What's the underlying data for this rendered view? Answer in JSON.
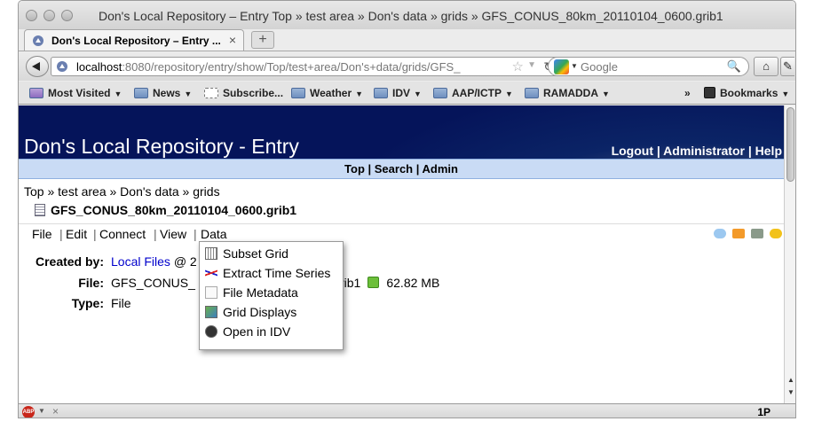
{
  "window": {
    "title": "Don's Local Repository – Entry Top » test area » Don's data » grids » GFS_CONUS_80km_20110104_0600.grib1"
  },
  "tab": {
    "label": "Don's Local Repository – Entry ...",
    "close": "×",
    "new_tab": "+"
  },
  "navbar": {
    "url_host": "localhost",
    "url_path": ":8080/repository/entry/show/Top/test+area/Don's+data/grids/GFS_",
    "search_placeholder": "Google"
  },
  "bookmarks": {
    "items": [
      {
        "label": "Most Visited",
        "has_menu": true
      },
      {
        "label": "News",
        "has_menu": true
      },
      {
        "label": "Subscribe...",
        "has_menu": false
      },
      {
        "label": "Weather",
        "has_menu": true
      },
      {
        "label": "IDV",
        "has_menu": true
      },
      {
        "label": "AAP/ICTP",
        "has_menu": true
      },
      {
        "label": "RAMADDA",
        "has_menu": true
      }
    ],
    "overflow": "»",
    "bookmarks_label": "Bookmarks"
  },
  "site": {
    "title": "Don's Local Repository - Entry",
    "header_links": "Logout | Administrator | Help",
    "topnav": "Top | Search | Admin"
  },
  "entry": {
    "breadcrumb": "Top » test area » Don's data » grids",
    "name": "GFS_CONUS_80km_20110104_0600.grib1",
    "menu": {
      "file": "File",
      "edit": "Edit",
      "connect": "Connect",
      "view": "View",
      "data": "Data",
      "sep": "|"
    },
    "properties": {
      "created_by_label": "Created by:",
      "created_by_value": "Local Files",
      "created_by_suffix": "@ 2",
      "file_label": "File:",
      "file_value_start": "GFS_CONUS_",
      "file_value_end": "rib1",
      "file_size": "62.82 MB",
      "type_label": "Type:",
      "type_value": "File"
    }
  },
  "data_menu": {
    "items": [
      {
        "label": "Subset Grid",
        "icon": "subset-grid-icon"
      },
      {
        "label": "Extract Time Series",
        "icon": "time-series-icon"
      },
      {
        "label": "File Metadata",
        "icon": "metadata-icon"
      },
      {
        "label": "Grid Displays",
        "icon": "grid-displays-icon"
      },
      {
        "label": "Open in IDV",
        "icon": "idv-icon"
      }
    ]
  },
  "status": {
    "right": "1P",
    "abp_label": "ABP"
  },
  "colors": {
    "banner": "#05145a",
    "topnav": "#c9dbf5",
    "link": "#0000cc"
  }
}
